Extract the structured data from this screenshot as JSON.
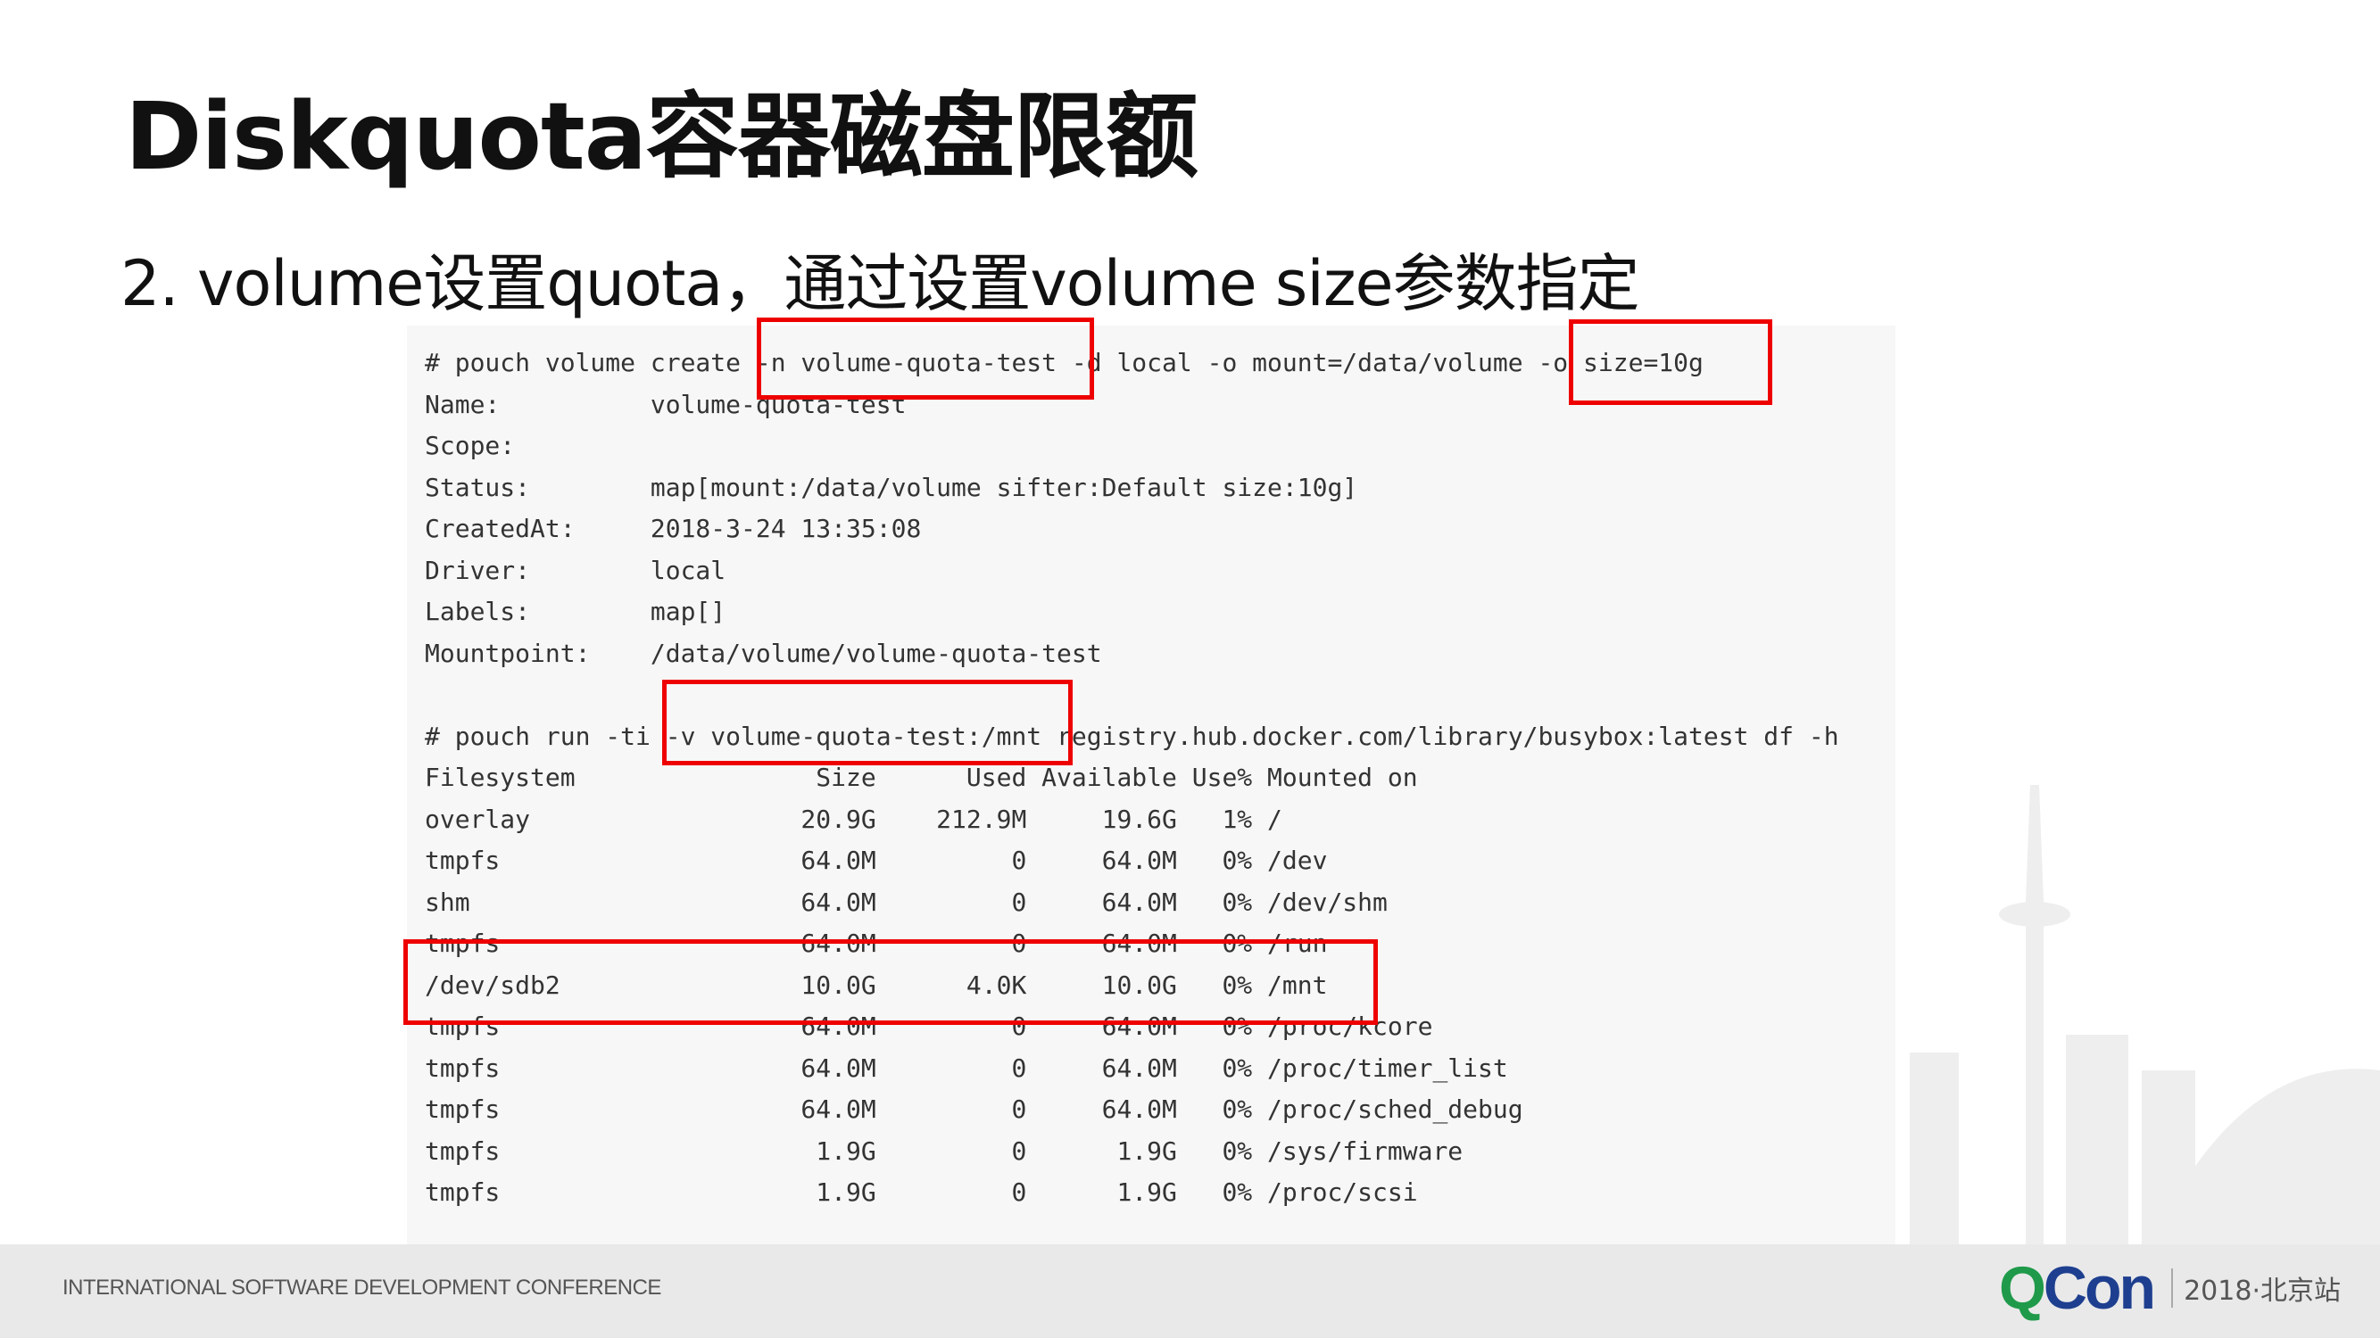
{
  "slide": {
    "title": "Diskquota容器磁盘限额",
    "subtitle": "2. volume设置quota，通过设置volume size参数指定"
  },
  "terminal": {
    "lines": [
      "# pouch volume create -n volume-quota-test -d local -o mount=/data/volume -o size=10g",
      "Name:          volume-quota-test",
      "Scope:",
      "Status:        map[mount:/data/volume sifter:Default size:10g]",
      "CreatedAt:     2018-3-24 13:35:08",
      "Driver:        local",
      "Labels:        map[]",
      "Mountpoint:    /data/volume/volume-quota-test",
      "",
      "# pouch run -ti -v volume-quota-test:/mnt registry.hub.docker.com/library/busybox:latest df -h",
      "Filesystem                Size      Used Available Use% Mounted on",
      "overlay                  20.9G    212.9M     19.6G   1% /",
      "tmpfs                    64.0M         0     64.0M   0% /dev",
      "shm                      64.0M         0     64.0M   0% /dev/shm",
      "tmpfs                    64.0M         0     64.0M   0% /run",
      "/dev/sdb2                10.0G      4.0K     10.0G   0% /mnt",
      "tmpfs                    64.0M         0     64.0M   0% /proc/kcore",
      "tmpfs                    64.0M         0     64.0M   0% /proc/timer_list",
      "tmpfs                    64.0M         0     64.0M   0% /proc/sched_debug",
      "tmpfs                     1.9G         0      1.9G   0% /sys/firmware",
      "tmpfs                     1.9G         0      1.9G   0% /proc/scsi"
    ]
  },
  "footer": {
    "conference": "INTERNATIONAL SOFTWARE DEVELOPMENT CONFERENCE",
    "logo_q": "Q",
    "logo_con": "Con",
    "event": "2018·北京站"
  },
  "colors": {
    "highlight": "#ee0000",
    "logo_green": "#1f9a4a",
    "logo_blue": "#1e3f8f"
  },
  "icons": {
    "background": "city-skyline-illustration"
  }
}
